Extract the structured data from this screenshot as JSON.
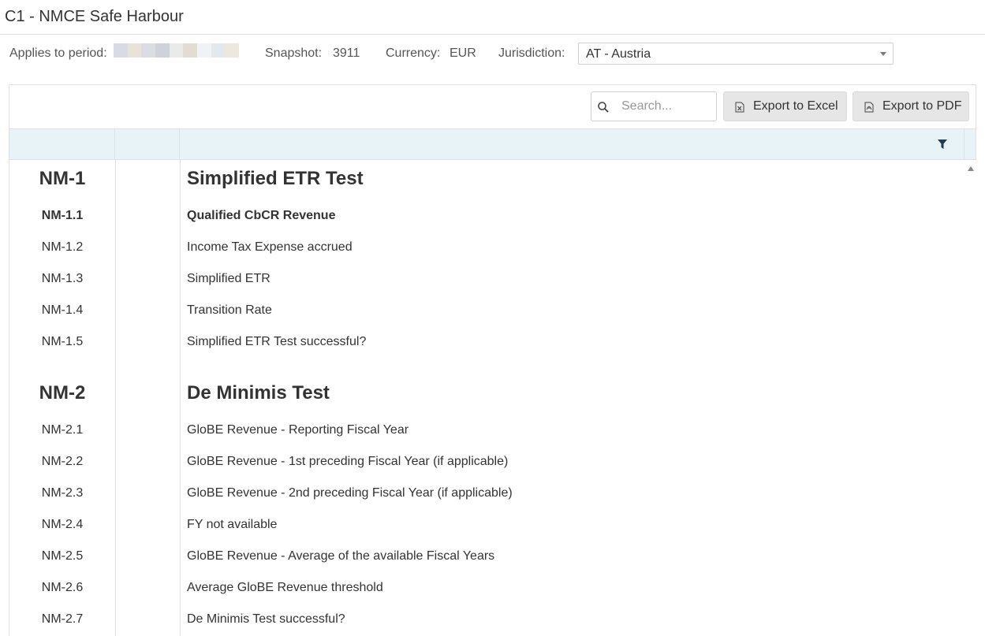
{
  "page": {
    "title": "C1 - NMCE Safe Harbour"
  },
  "filters": {
    "period_label": "Applies to period:",
    "snapshot_label": "Snapshot:",
    "snapshot_value": "3911",
    "currency_label": "Currency:",
    "currency_value": "EUR",
    "jurisdiction_label": "Jurisdiction:",
    "jurisdiction_value": "AT - Austria"
  },
  "toolbar": {
    "search_placeholder": "Search...",
    "export_excel_label": "Export to Excel",
    "export_pdf_label": "Export to PDF"
  },
  "rows": [
    {
      "code": "NM-1",
      "label": "Simplified ETR Test",
      "type": "section"
    },
    {
      "code": "NM-1.1",
      "label": "Qualified CbCR Revenue",
      "type": "item-bold"
    },
    {
      "code": "NM-1.2",
      "label": "Income Tax Expense accrued",
      "type": "item"
    },
    {
      "code": "NM-1.3",
      "label": "Simplified ETR",
      "type": "item"
    },
    {
      "code": "NM-1.4",
      "label": "Transition Rate",
      "type": "item"
    },
    {
      "code": "NM-1.5",
      "label": "Simplified ETR Test successful?",
      "type": "item"
    },
    {
      "code": "NM-2",
      "label": "De Minimis Test",
      "type": "section"
    },
    {
      "code": "NM-2.1",
      "label": "GloBE Revenue - Reporting Fiscal Year",
      "type": "item"
    },
    {
      "code": "NM-2.2",
      "label": "GloBE Revenue - 1st preceding Fiscal Year (if applicable)",
      "type": "item"
    },
    {
      "code": "NM-2.3",
      "label": "GloBE Revenue - 2nd preceding Fiscal Year (if applicable)",
      "type": "item"
    },
    {
      "code": "NM-2.4",
      "label": "FY not available",
      "type": "item"
    },
    {
      "code": "NM-2.5",
      "label": "GloBE Revenue - Average of the available Fiscal Years",
      "type": "item"
    },
    {
      "code": "NM-2.6",
      "label": "Average GloBE Revenue threshold",
      "type": "item"
    },
    {
      "code": "NM-2.7",
      "label": "De Minimis Test successful?",
      "type": "item"
    }
  ],
  "colors": {
    "header_bg": "#e8f3f7",
    "button_bg": "#e6e6e6"
  },
  "icons": [
    "search-icon",
    "excel-file-icon",
    "pdf-file-icon",
    "filter-icon",
    "chevron-down-icon",
    "scroll-up-arrow-icon"
  ]
}
